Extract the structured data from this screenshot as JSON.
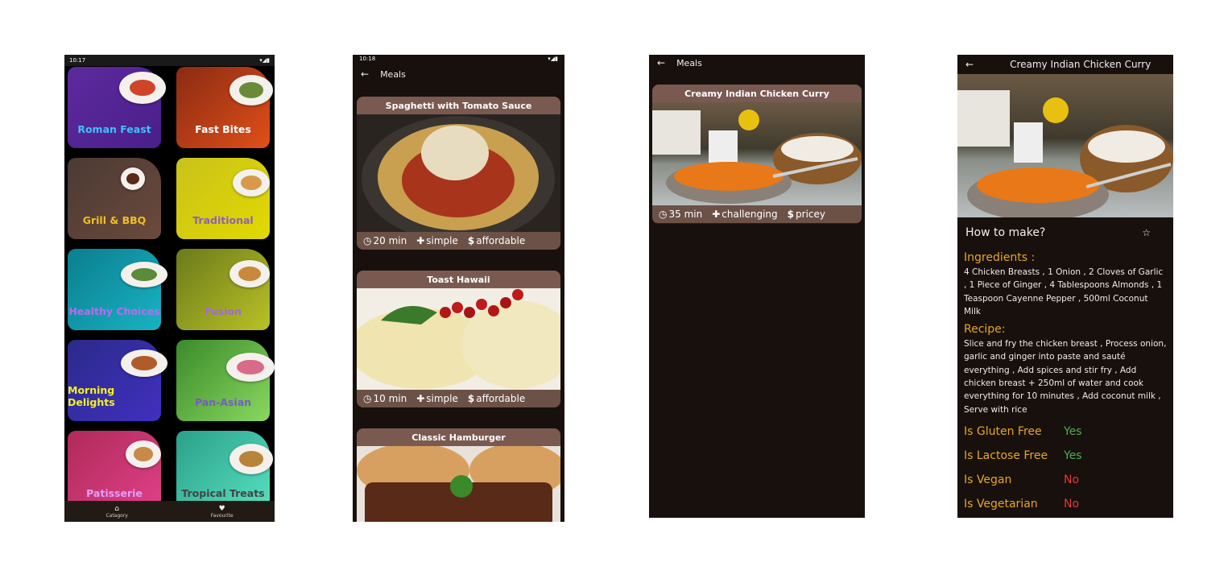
{
  "screen1": {
    "status_time": "10:17",
    "categories": [
      {
        "label": "Roman Feast",
        "bg": "linear-gradient(135deg,#5c2a9e,#4a1f8a)",
        "color": "#40c0ff",
        "food": "#d0452a"
      },
      {
        "label": "Fast Bites",
        "bg": "linear-gradient(135deg,#8a2b12,#e04f1a)",
        "color": "#ffffff",
        "food": "#6a8a3a"
      },
      {
        "label": "Grill & BBQ",
        "bg": "linear-gradient(135deg,#4b3a34,#6b4a3c)",
        "color": "#f0c020",
        "food": "#5a2a18"
      },
      {
        "label": "Traditional",
        "bg": "linear-gradient(135deg,#c9c21a,#e2d900)",
        "color": "#8b5fc0",
        "food": "#d89a4a"
      },
      {
        "label": "Healthy Choices",
        "bg": "linear-gradient(135deg,#0b7e8f,#18b3c4)",
        "color": "#b86cf0",
        "food": "#5a8a3a"
      },
      {
        "label": "Fusion",
        "bg": "linear-gradient(135deg,#6b7a1a,#b9c226)",
        "color": "#a06cd5",
        "food": "#c88a3a"
      },
      {
        "label": "Morning Delights",
        "bg": "linear-gradient(135deg,#2b2a8a,#4030c0)",
        "color": "#f5f020",
        "food": "#b35a2a"
      },
      {
        "label": "Pan-Asian",
        "bg": "linear-gradient(135deg,#3a8a2a,#8ad860)",
        "color": "#7a5ac8",
        "food": "#d86a8a"
      },
      {
        "label": "Patisserie",
        "bg": "linear-gradient(135deg,#b02a5a,#e04088)",
        "color": "#e0a0ff",
        "food": "#c88a4a"
      },
      {
        "label": "Tropical Treats",
        "bg": "linear-gradient(135deg,#2aa08a,#58e0c0)",
        "color": "#444444",
        "food": "#b8843a"
      }
    ],
    "nav": [
      {
        "label": "Catagory",
        "icon": "home-icon"
      },
      {
        "label": "Favourite",
        "icon": "heart-icon"
      }
    ]
  },
  "screen2": {
    "status_time": "10:18",
    "title": "Meals",
    "meals": [
      {
        "title": "Spaghetti with Tomato Sauce",
        "duration": "20 min",
        "complexity": "simple",
        "cost": "affordable"
      },
      {
        "title": "Toast Hawaii",
        "duration": "10 min",
        "complexity": "simple",
        "cost": "affordable"
      },
      {
        "title": "Classic Hamburger"
      }
    ]
  },
  "screen3": {
    "title": "Meals",
    "meal": {
      "title": "Creamy Indian Chicken Curry",
      "duration": "35 min",
      "complexity": "challenging",
      "cost": "pricey"
    }
  },
  "screen4": {
    "title": "Creamy Indian Chicken Curry",
    "how_to": "How to make?",
    "ingredients_heading": "Ingredients :",
    "ingredients": "4 Chicken Breasts , 1 Onion , 2 Cloves of Garlic , 1 Piece of Ginger , 4 Tablespoons Almonds , 1 Teaspoon Cayenne Pepper , 500ml Coconut Milk",
    "recipe_heading": "Recipe:",
    "recipe": "Slice and fry the chicken breast , Process onion, garlic and ginger into paste and sauté everything , Add spices and stir fry , Add chicken breast + 250ml of water and cook everything for 10 minutes , Add coconut milk , Serve with rice",
    "diet": [
      {
        "label": "Is Gluten Free",
        "value": "Yes",
        "color": "#4caf50"
      },
      {
        "label": "Is Lactose Free",
        "value": "Yes",
        "color": "#4caf50"
      },
      {
        "label": "Is Vegan",
        "value": "No",
        "color": "#e53935"
      },
      {
        "label": "Is Vegetarian",
        "value": "No",
        "color": "#e53935"
      }
    ]
  }
}
